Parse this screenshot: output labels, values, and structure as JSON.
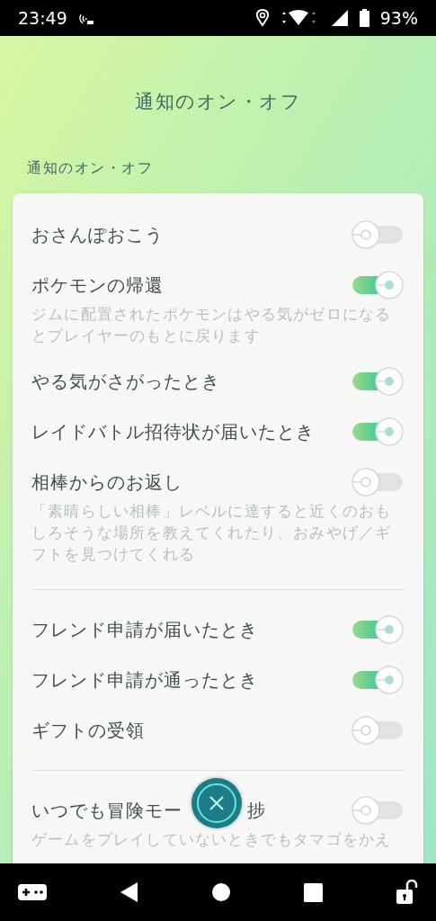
{
  "status_bar": {
    "time": "23:49",
    "battery": "93%"
  },
  "header": {
    "title": "通知のオン・オフ"
  },
  "section": {
    "label": "通知のオン・オフ"
  },
  "groups": [
    {
      "items": [
        {
          "label": "おさんぽおこう",
          "on": false
        },
        {
          "label": "ポケモンの帰還",
          "on": true,
          "description": "ジムに配置されたポケモンはやる気がゼロになるとプレイヤーのもとに戻ります"
        },
        {
          "label": "やる気がさがったとき",
          "on": true
        },
        {
          "label": "レイドバトル招待状が届いたとき",
          "on": true
        },
        {
          "label": "相棒からのお返し",
          "on": false,
          "description": "「素晴らしい相棒」レベルに達すると近くのおもしろそうな場所を教えてくれたり、おみやげ／ギフトを見つけてくれる"
        }
      ]
    },
    {
      "items": [
        {
          "label": "フレンド申請が届いたとき",
          "on": true
        },
        {
          "label": "フレンド申請が通ったとき",
          "on": true
        },
        {
          "label": "ギフトの受領",
          "on": false
        }
      ]
    },
    {
      "items": [
        {
          "label": "いつでも冒険モー",
          "label_end": "捗",
          "on": false,
          "description": "ゲームをプレイしていないときでもタマゴをかえ"
        }
      ]
    }
  ]
}
